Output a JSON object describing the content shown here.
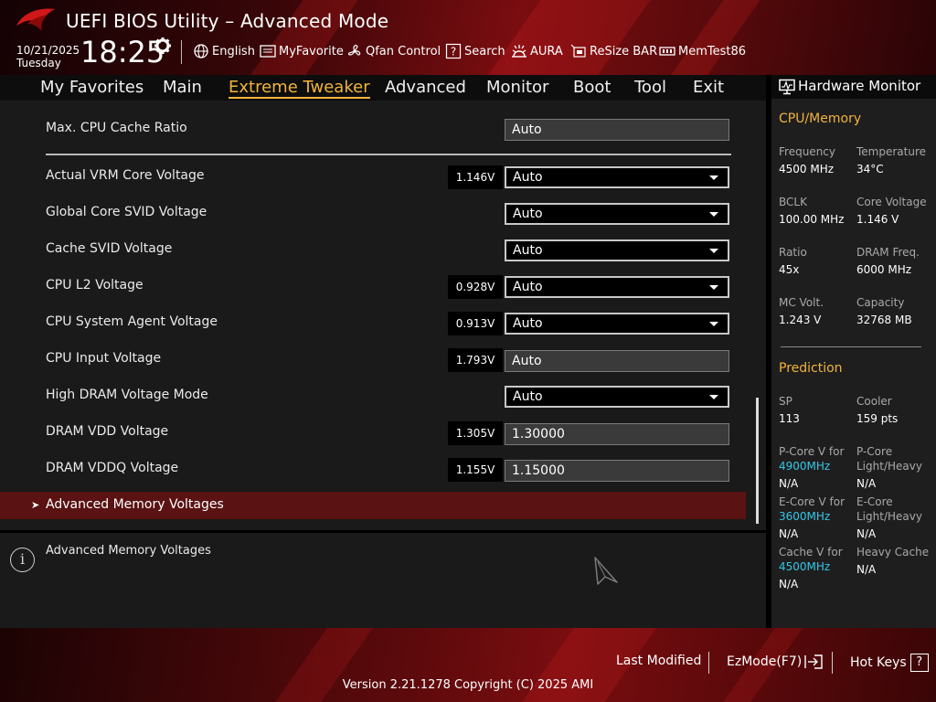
{
  "header": {
    "title": "UEFI BIOS Utility – Advanced Mode",
    "date": "10/21/2025",
    "weekday": "Tuesday",
    "time": "18:25",
    "toolbar": [
      {
        "label": "English",
        "icon": "globe-icon"
      },
      {
        "label": "MyFavorite",
        "icon": "favorite-list-icon"
      },
      {
        "label": "Qfan Control",
        "icon": "fan-icon"
      },
      {
        "label": "Search",
        "icon": "search-help-icon"
      },
      {
        "label": "AURA",
        "icon": "aura-light-icon"
      },
      {
        "label": "ReSize BAR",
        "icon": "resize-bar-icon"
      },
      {
        "label": "MemTest86",
        "icon": "memory-icon"
      }
    ]
  },
  "tabs": [
    {
      "label": "My Favorites",
      "active": false
    },
    {
      "label": "Main",
      "active": false
    },
    {
      "label": "Extreme Tweaker",
      "active": true
    },
    {
      "label": "Advanced",
      "active": false
    },
    {
      "label": "Monitor",
      "active": false
    },
    {
      "label": "Boot",
      "active": false
    },
    {
      "label": "Tool",
      "active": false
    },
    {
      "label": "Exit",
      "active": false
    }
  ],
  "settings": {
    "cache_ratio": {
      "label": "Max. CPU Cache Ratio",
      "value": "Auto"
    },
    "items": [
      {
        "label": "Actual VRM Core Voltage",
        "readout": "1.146V",
        "value": "Auto",
        "kind": "select"
      },
      {
        "label": "Global Core SVID Voltage",
        "readout": "",
        "value": "Auto",
        "kind": "select"
      },
      {
        "label": "Cache SVID Voltage",
        "readout": "",
        "value": "Auto",
        "kind": "select"
      },
      {
        "label": "CPU L2 Voltage",
        "readout": "0.928V",
        "value": "Auto",
        "kind": "select"
      },
      {
        "label": "CPU System Agent Voltage",
        "readout": "0.913V",
        "value": "Auto",
        "kind": "select"
      },
      {
        "label": "CPU Input Voltage",
        "readout": "1.793V",
        "value": "Auto",
        "kind": "text"
      },
      {
        "label": "High DRAM Voltage Mode",
        "readout": "",
        "value": "Auto",
        "kind": "select"
      },
      {
        "label": "DRAM VDD Voltage",
        "readout": "1.305V",
        "value": "1.30000",
        "kind": "text"
      },
      {
        "label": "DRAM VDDQ Voltage",
        "readout": "1.155V",
        "value": "1.15000",
        "kind": "text"
      }
    ],
    "submenu": {
      "label": "Advanced Memory Voltages",
      "arrow": "➤"
    }
  },
  "help": {
    "text": "Advanced Memory Voltages",
    "icon": "info-icon"
  },
  "hardware_monitor": {
    "title": "Hardware Monitor",
    "cpu_memory": {
      "section": "CPU/Memory",
      "frequency": {
        "label": "Frequency",
        "value": "4500 MHz"
      },
      "temperature": {
        "label": "Temperature",
        "value": "34°C"
      },
      "bclk": {
        "label": "BCLK",
        "value": "100.00 MHz"
      },
      "core_voltage": {
        "label": "Core Voltage",
        "value": "1.146 V"
      },
      "ratio": {
        "label": "Ratio",
        "value": "45x"
      },
      "dram_freq": {
        "label": "DRAM Freq.",
        "value": "6000 MHz"
      },
      "mc_volt": {
        "label": "MC Volt.",
        "value": "1.243 V"
      },
      "capacity": {
        "label": "Capacity",
        "value": "32768 MB"
      }
    },
    "prediction": {
      "section": "Prediction",
      "sp": {
        "label": "SP",
        "value": "113"
      },
      "cooler": {
        "label": "Cooler",
        "value": "159 pts"
      },
      "pcore_v": {
        "label": "P-Core V for",
        "freq": "4900MHz",
        "value": "N/A"
      },
      "pcore_lh": {
        "label1": "P-Core",
        "label2": "Light/Heavy",
        "value": "N/A"
      },
      "ecore_v": {
        "label": "E-Core V for",
        "freq": "3600MHz",
        "value": "N/A"
      },
      "ecore_lh": {
        "label1": "E-Core",
        "label2": "Light/Heavy",
        "value": "N/A"
      },
      "cache_v": {
        "label": "Cache V for",
        "freq": "4500MHz",
        "value": "N/A"
      },
      "heavy_cache": {
        "label": "Heavy Cache",
        "value": "N/A"
      }
    }
  },
  "footer": {
    "last_modified": "Last Modified",
    "ezmode": "EzMode(F7)",
    "hot_keys": "Hot Keys",
    "hot_keys_glyph": "?",
    "version": "Version 2.21.1278 Copyright (C) 2025 AMI"
  },
  "colors": {
    "accent": "#f2b33d",
    "highlight_freq": "#35c7e8",
    "submenu_bg": "#5a1212",
    "brand_red": "#7a0d10"
  }
}
